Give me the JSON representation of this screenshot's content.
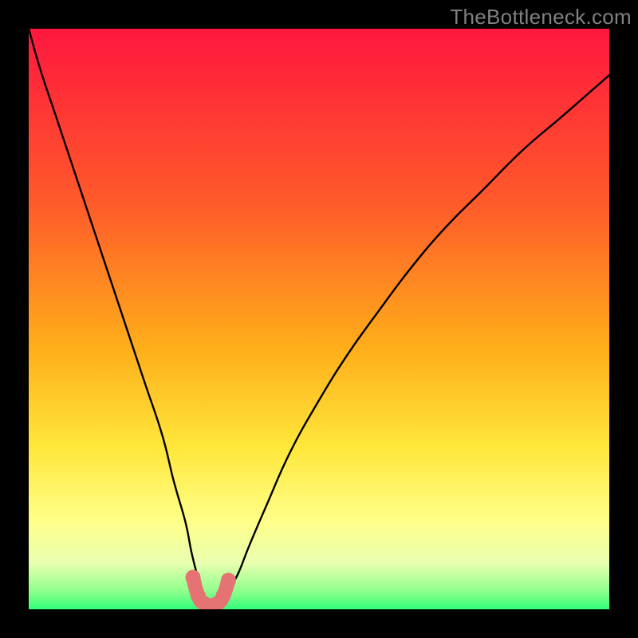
{
  "watermark": "TheBottleneck.com",
  "chart_data": {
    "type": "line",
    "title": "",
    "xlabel": "",
    "ylabel": "",
    "xlim": [
      0,
      100
    ],
    "ylim": [
      0,
      100
    ],
    "background_gradient": {
      "stops": [
        {
          "pos": 0.0,
          "color": "#ff173e"
        },
        {
          "pos": 0.3,
          "color": "#ff5a2a"
        },
        {
          "pos": 0.55,
          "color": "#ffae1a"
        },
        {
          "pos": 0.72,
          "color": "#ffe73a"
        },
        {
          "pos": 0.85,
          "color": "#ffff8a"
        },
        {
          "pos": 0.92,
          "color": "#e9ffb0"
        },
        {
          "pos": 0.97,
          "color": "#8cff8c"
        },
        {
          "pos": 1.0,
          "color": "#32ff7a"
        }
      ]
    },
    "series": [
      {
        "name": "bottleneck-curve",
        "color": "#000000",
        "x": [
          0.0,
          2,
          5,
          8,
          11,
          14,
          17,
          20,
          23,
          25,
          27,
          28,
          29,
          30,
          31,
          32,
          33,
          34,
          36,
          38,
          41,
          45,
          50,
          55,
          60,
          66,
          72,
          78,
          85,
          92,
          100
        ],
        "y": [
          100,
          93,
          84,
          75,
          66,
          57,
          48,
          39,
          30,
          22,
          15,
          10,
          6,
          3,
          1.2,
          0.6,
          1.0,
          2.5,
          6,
          11,
          18,
          27,
          36,
          44,
          51,
          59,
          66,
          72,
          79,
          85,
          92
        ]
      },
      {
        "name": "trough-marker",
        "type": "scatter",
        "color": "#e57373",
        "x": [
          28.3,
          29.2,
          30.2,
          31.4,
          32.5,
          33.5,
          34.4
        ],
        "y": [
          5.5,
          2.3,
          1.0,
          0.6,
          1.0,
          2.3,
          5.0
        ]
      }
    ]
  }
}
